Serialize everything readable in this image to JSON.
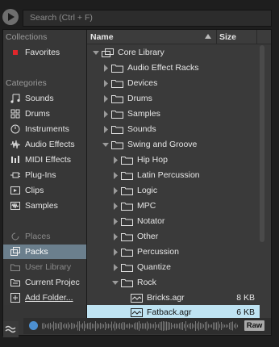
{
  "search": {
    "placeholder": "Search (Ctrl + F)"
  },
  "sidebar": {
    "collections_heading": "Collections",
    "favorites": "Favorites",
    "categories_heading": "Categories",
    "categories": [
      "Sounds",
      "Drums",
      "Instruments",
      "Audio Effects",
      "MIDI Effects",
      "Plug-Ins",
      "Clips",
      "Samples"
    ],
    "places_heading": "Places",
    "places": [
      "Packs",
      "User Library",
      "Current Projec",
      "Add Folder..."
    ]
  },
  "list": {
    "col_name": "Name",
    "col_size": "Size",
    "rows": [
      {
        "label": "Core Library",
        "size": ""
      },
      {
        "label": "Audio Effect Racks",
        "size": ""
      },
      {
        "label": "Devices",
        "size": ""
      },
      {
        "label": "Drums",
        "size": ""
      },
      {
        "label": "Samples",
        "size": ""
      },
      {
        "label": "Sounds",
        "size": ""
      },
      {
        "label": "Swing and Groove",
        "size": ""
      },
      {
        "label": "Hip Hop",
        "size": ""
      },
      {
        "label": "Latin Percussion",
        "size": ""
      },
      {
        "label": "Logic",
        "size": ""
      },
      {
        "label": "MPC",
        "size": ""
      },
      {
        "label": "Notator",
        "size": ""
      },
      {
        "label": "Other",
        "size": ""
      },
      {
        "label": "Percussion",
        "size": ""
      },
      {
        "label": "Quantize",
        "size": ""
      },
      {
        "label": "Rock",
        "size": ""
      },
      {
        "label": "Bricks.agr",
        "size": "8 KB"
      },
      {
        "label": "Fatback.agr",
        "size": "6 KB"
      }
    ]
  },
  "bottom": {
    "raw_label": "Raw"
  },
  "colors": {
    "selection": "#bfe3f2",
    "sidebar_selected": "#6b7f8d",
    "favorite": "#e0262b",
    "help": "#4c8fd0"
  }
}
